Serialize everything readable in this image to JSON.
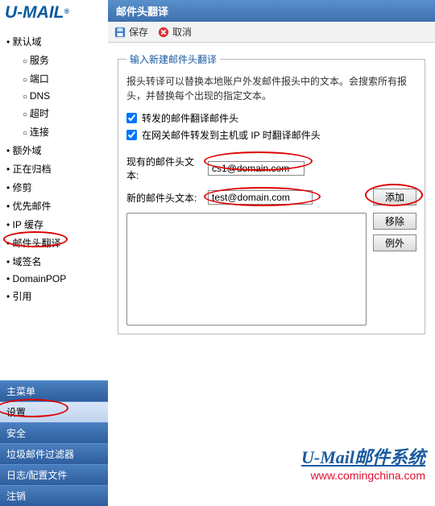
{
  "logo": {
    "text": "U-MAIL",
    "reg": "®"
  },
  "nav": {
    "items": [
      "默认域",
      "额外域",
      "正在归档",
      "修剪",
      "优先邮件",
      "IP 缓存",
      "邮件头翻译",
      "域签名",
      "DomainPOP",
      "引用"
    ],
    "sub0": [
      "服务",
      "端口",
      "DNS",
      "超时",
      "连接"
    ],
    "active_index": 6
  },
  "bottom_menu": {
    "items": [
      "主菜单",
      "设置",
      "安全",
      "垃圾邮件过滤器",
      "日志/配置文件",
      "注销"
    ],
    "active_index": 1
  },
  "main": {
    "title": "邮件头翻译",
    "toolbar": {
      "save": "保存",
      "cancel": "取消"
    },
    "fieldset": {
      "legend": "输入新建邮件头翻译",
      "desc": "报头转译可以替换本地账户外发邮件报头中的文本。会搜索所有报头，并替换每个出现的指定文本。",
      "check1": "转发的邮件翻译邮件头",
      "check2": "在网关邮件转发到主机或 IP 时翻译邮件头",
      "row1_label": "现有的邮件头文本:",
      "row1_value": "cs1@domain.com",
      "row2_label": "新的邮件头文本:",
      "row2_value": "test@domain.com",
      "add_btn": "添加",
      "remove_btn": "移除",
      "except_btn": "例外"
    }
  },
  "watermark": {
    "title": "U-Mail邮件系统",
    "url": "www.comingchina.com"
  }
}
